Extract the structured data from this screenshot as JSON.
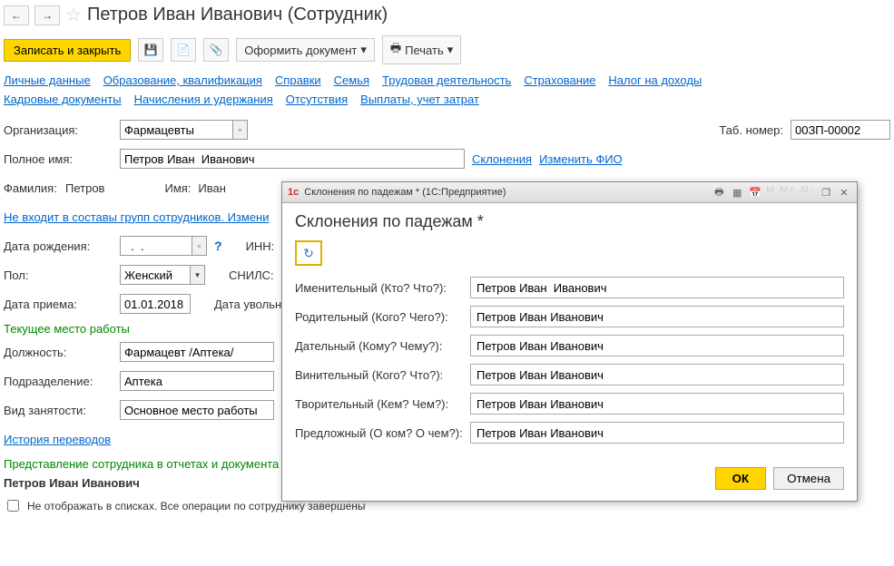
{
  "header": {
    "title": "Петров Иван  Иванович (Сотрудник)"
  },
  "toolbar": {
    "save_close": "Записать и закрыть",
    "make_doc": "Оформить документ",
    "print": "Печать"
  },
  "tabs": {
    "personal": "Личные данные",
    "education": "Образование, квалификация",
    "refs": "Справки",
    "family": "Семья",
    "work": "Трудовая деятельность",
    "insurance": "Страхование",
    "tax": "Налог на доходы",
    "hr_docs": "Кадровые документы",
    "payroll": "Начисления и удержания",
    "absence": "Отсутствия",
    "payments": "Выплаты, учет затрат"
  },
  "form": {
    "org_label": "Организация:",
    "org_value": "Фармацевты",
    "tab_no_label": "Таб. номер:",
    "tab_no_value": "00ЗП-00002",
    "fullname_label": "Полное имя:",
    "fullname_value": "Петров Иван  Иванович",
    "decl_link": "Склонения",
    "change_fio_link": "Изменить ФИО",
    "surname_label": "Фамилия:",
    "surname_value": "Петров",
    "name_label": "Имя:",
    "name_value": "Иван",
    "groups_link": "Не входит в составы групп сотрудников. Измени",
    "dob_label": "Дата рождения:",
    "dob_value": "  .  .    ",
    "inn_label": "ИНН:",
    "gender_label": "Пол:",
    "gender_value": "Женский",
    "snils_label": "СНИЛС:",
    "hire_label": "Дата приема:",
    "hire_value": "01.01.2018",
    "fire_label": "Дата увольнен",
    "current_job": "Текущее место работы",
    "position_label": "Должность:",
    "position_value": "Фармацевт /Аптека/",
    "dept_label": "Подразделение:",
    "dept_value": "Аптека",
    "emp_type_label": "Вид занятости:",
    "emp_type_value": "Основное место работы",
    "history_link": "История переводов",
    "repr_text": "Представление сотрудника в отчетах и документа",
    "emp_name": "Петров Иван  Иванович",
    "hide_checkbox": "Не отображать в списках. Все операции по сотруднику завершены"
  },
  "modal": {
    "titlebar": "Склонения по падежам *  (1С:Предприятие)",
    "heading": "Склонения по падежам *",
    "nom_label": "Именительный (Кто? Что?):",
    "nom_value": "Петров Иван  Иванович",
    "gen_label": "Родительный (Кого? Чего?):",
    "gen_value": "Петров Иван Иванович",
    "dat_label": "Дательный (Кому? Чему?):",
    "dat_value": "Петров Иван Иванович",
    "acc_label": "Винительный (Кого? Что?):",
    "acc_value": "Петров Иван Иванович",
    "ins_label": "Творительный (Кем? Чем?):",
    "ins_value": "Петров Иван Иванович",
    "pre_label": "Предложный (О ком? О чем?):",
    "pre_value": "Петров Иван Иванович",
    "ok": "ОК",
    "cancel": "Отмена"
  }
}
